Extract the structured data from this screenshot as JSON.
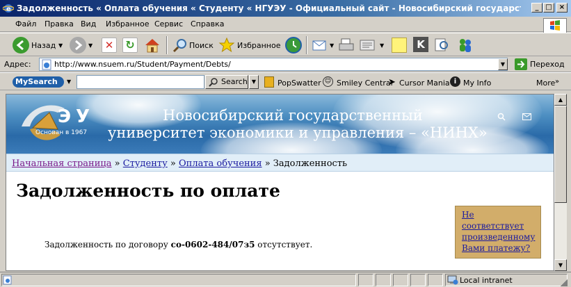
{
  "window": {
    "title": "Задолженность « Оплата обучения « Студенту « НГУЭУ - Официальный сайт - Новосибирский государст - Microsoft Interne...",
    "minimize": "_",
    "maximize": "□",
    "close": "×"
  },
  "menu": [
    "Файл",
    "Правка",
    "Вид",
    "Избранное",
    "Сервис",
    "Справка"
  ],
  "toolbar": {
    "back": "Назад",
    "search": "Поиск",
    "favorites": "Избранное"
  },
  "address": {
    "label": "Адрес:",
    "url": "http://www.nsuem.ru/Student/Payment/Debts/",
    "go": "Переход"
  },
  "mysearch": {
    "logo": "MySearch",
    "button": "Search",
    "links": [
      "PopSwatter",
      "Smiley Central",
      "Cursor Mania",
      "My Info"
    ],
    "more": "More"
  },
  "page": {
    "banner": {
      "line1": "Новосибирский государственный",
      "line2": "университет экономики и управления – «НИНХ»",
      "established": "Основан в 1967"
    },
    "breadcrumb": {
      "items": [
        "Начальная страница",
        "Студенту",
        "Оплата обучения"
      ],
      "separator": "»",
      "current": "Задолженность"
    },
    "title": "Задолженность по оплате",
    "debt": {
      "prefix": "Задолженность по договору",
      "contract": "со-0602-484/07з5",
      "suffix": "отсутствует."
    },
    "side_link": "Не соответствует произведенному Вами платежу?"
  },
  "status": {
    "zone": "Local intranet"
  },
  "colors": {
    "titlebar": "#0a246a",
    "chrome": "#d4d0c8",
    "breadcrumb_bg": "#e1eef8",
    "side_box": "#d2ad6a"
  }
}
